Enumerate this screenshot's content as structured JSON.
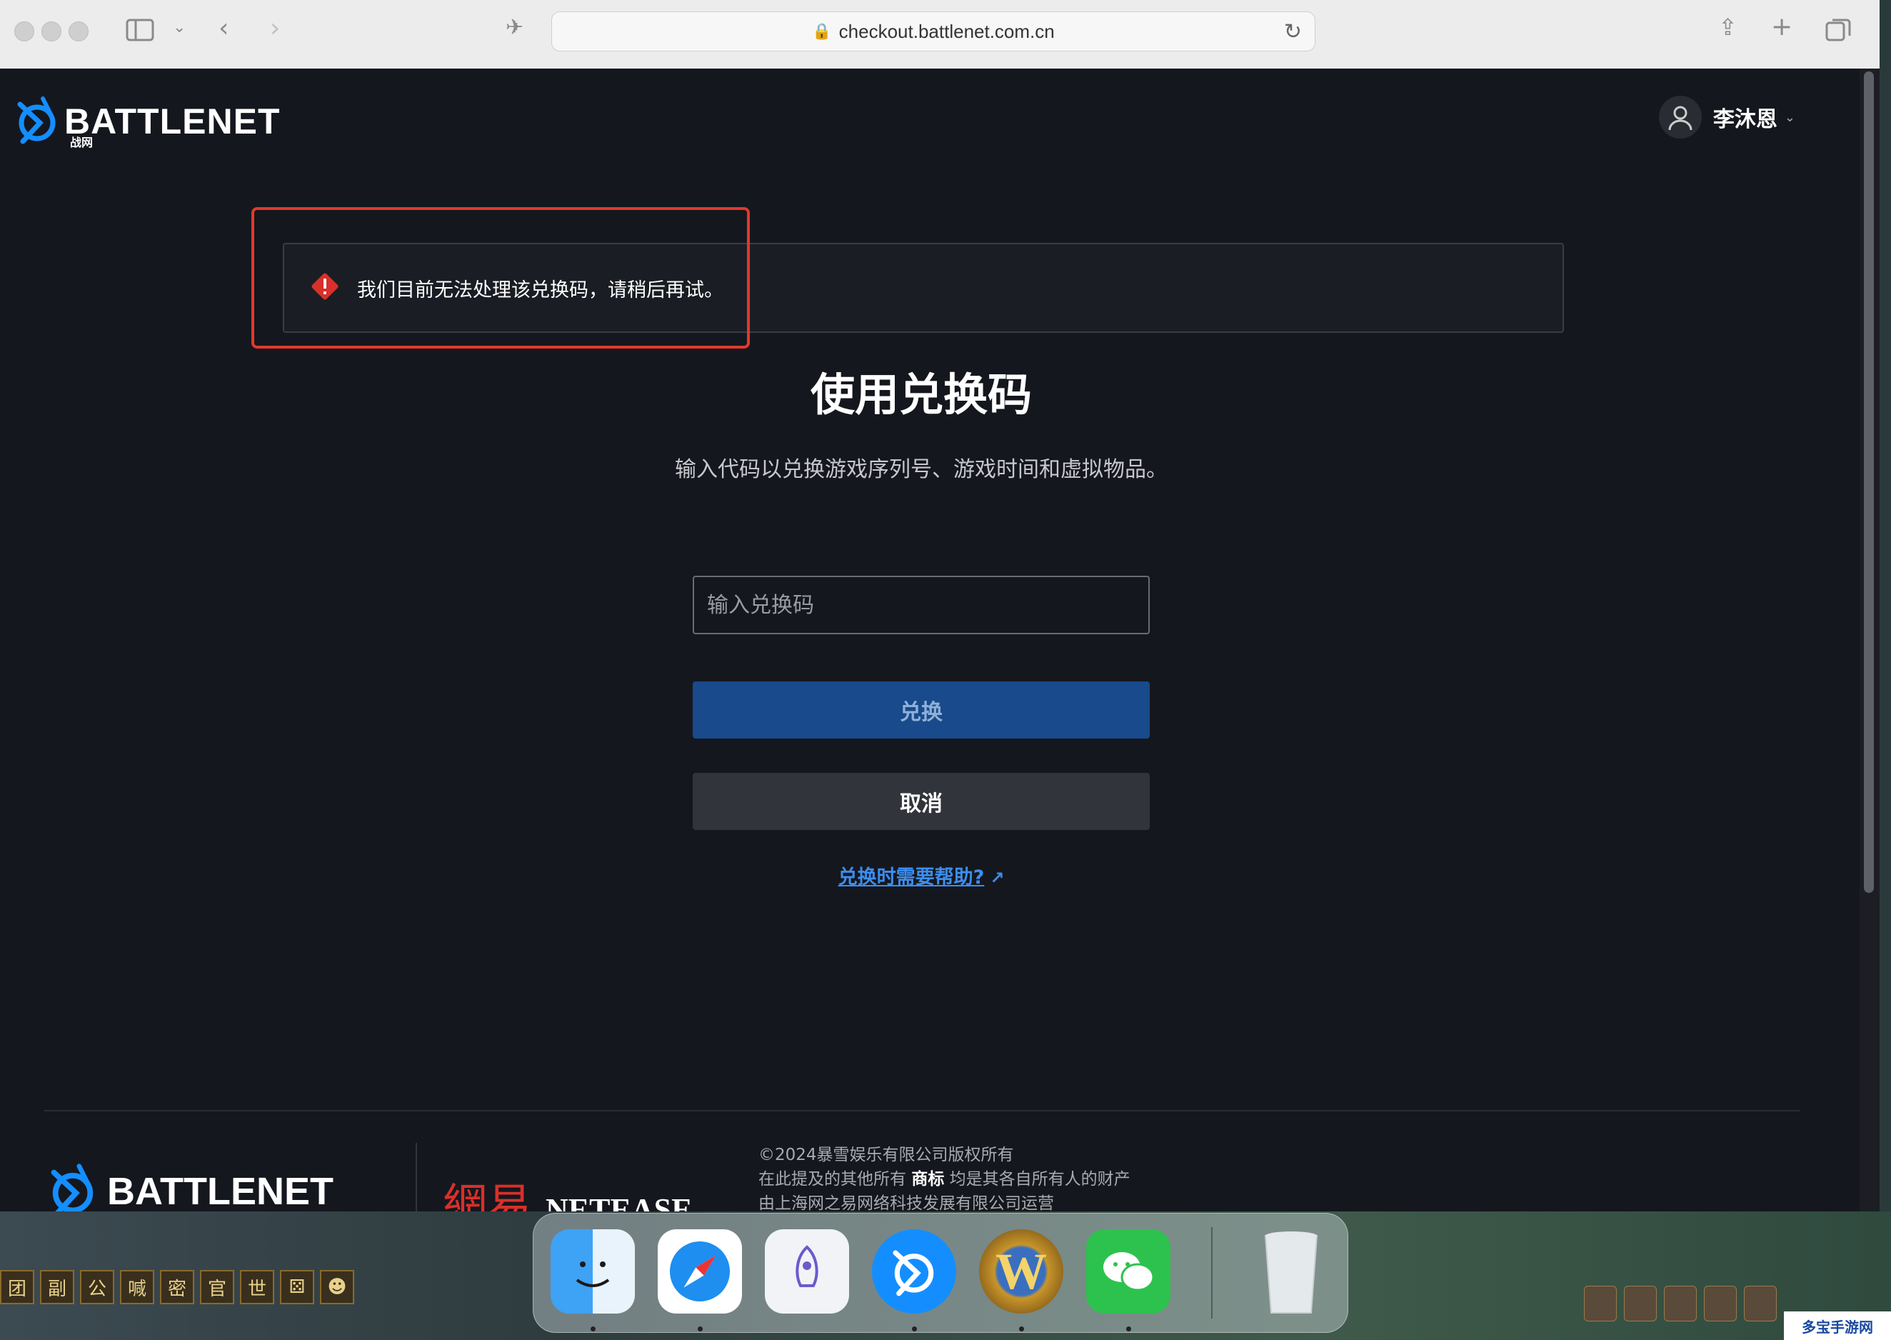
{
  "browser": {
    "url": "checkout.battlenet.com.cn"
  },
  "header": {
    "logo_text": "BATTLENET",
    "logo_sub": "战网",
    "username": "李沐恩"
  },
  "alert": {
    "message": "我们目前无法处理该兑换码，请稍后再试。"
  },
  "main": {
    "title": "使用兑换码",
    "subtitle": "输入代码以兑换游戏序列号、游戏时间和虚拟物品。",
    "code_placeholder": "输入兑换码",
    "redeem_label": "兑换",
    "cancel_label": "取消",
    "help_link": "兑换时需要帮助?"
  },
  "footer": {
    "logo_text": "BATTLENET",
    "netease_cn": "網易",
    "netease_en": "NETEASE",
    "copyright": "©2024暴雪娱乐有限公司版权所有",
    "trademark_prefix": "在此提及的其他所有",
    "trademark_word": "商标",
    "trademark_suffix": "均是其各自所有人的财产",
    "operator": "由上海网之易网络科技发展有限公司运营"
  },
  "game_bar": [
    "团",
    "副",
    "公",
    "喊",
    "密",
    "官",
    "世"
  ],
  "dock": {
    "apps": [
      "finder-icon",
      "safari-icon",
      "launchpad-icon",
      "battlenet-icon",
      "wow-icon",
      "wechat-icon",
      "trash-icon"
    ],
    "wow_letter": "W"
  },
  "watermark": "多宝手游网",
  "colors": {
    "page_bg": "#15171e",
    "primary_button": "#184a8c",
    "secondary_button": "#32343b",
    "alert_icon": "#d8302a",
    "highlight": "#e0392b",
    "link": "#3b8ef0"
  }
}
